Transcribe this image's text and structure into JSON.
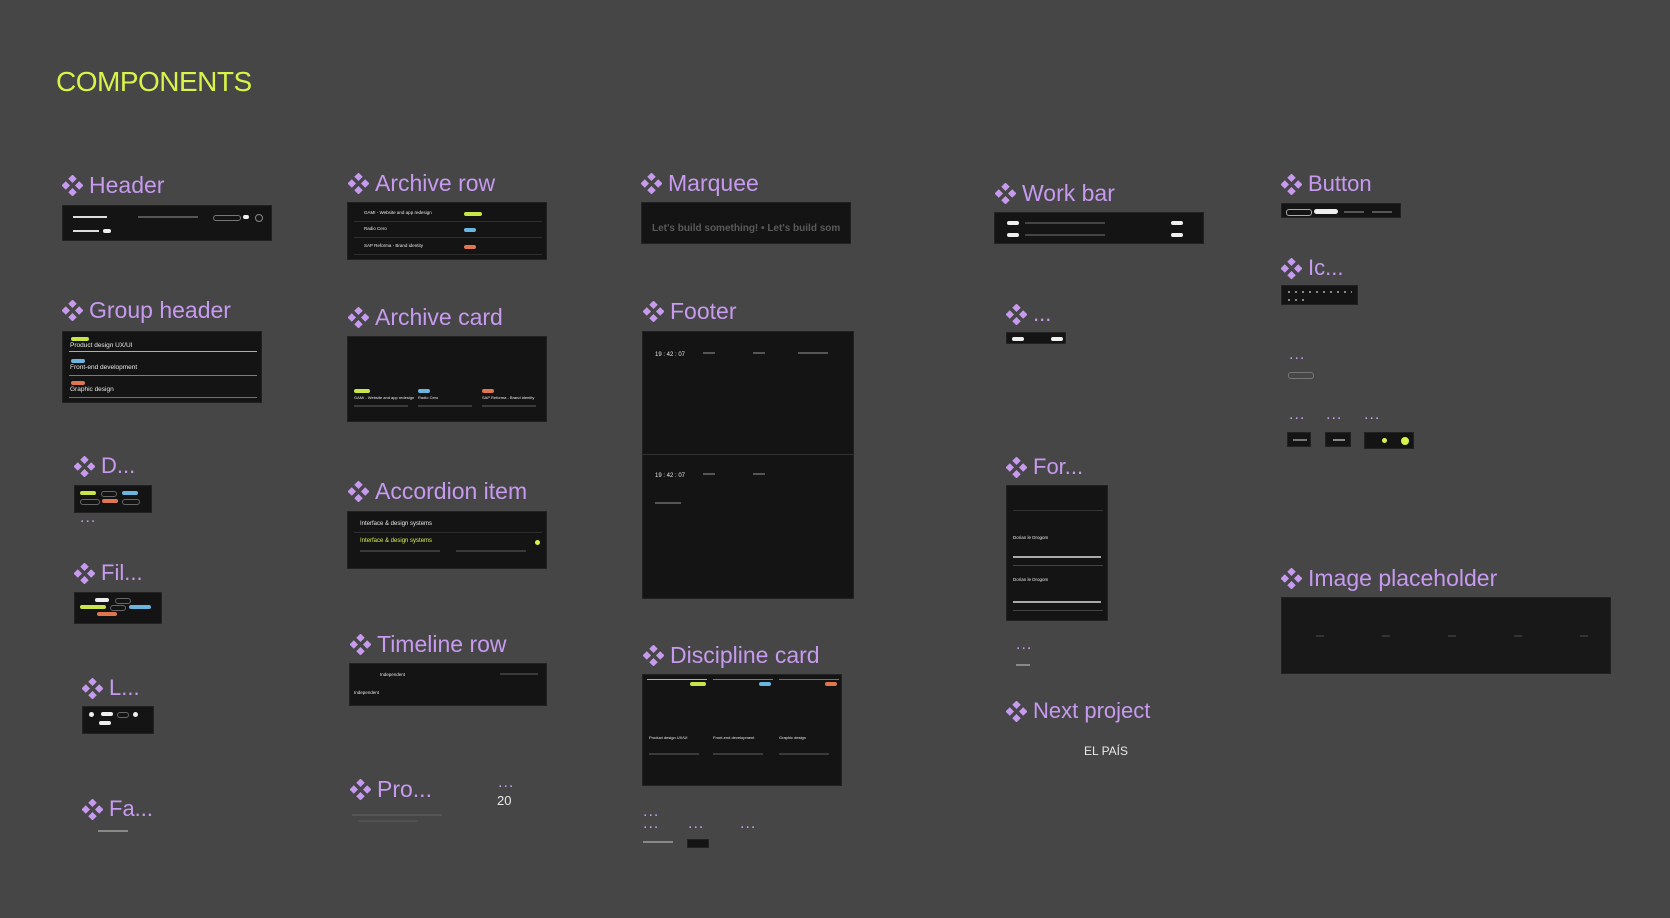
{
  "page": {
    "title": "COMPONENTS"
  },
  "colors": {
    "background": "#464646",
    "accent_title": "#d8f34a",
    "component_label": "#c79af0",
    "frame_bg": "#141414"
  },
  "icon": "component-diamond-icon",
  "components": {
    "header": "Header",
    "group_header": "Group header",
    "d": "D...",
    "fil": "Fil...",
    "l": "L...",
    "fa": "Fa...",
    "archive_row": "Archive row",
    "archive_card": "Archive card",
    "accordion_item": "Accordion item",
    "timeline_row": "Timeline row",
    "pro": "Pro...",
    "marquee": "Marquee",
    "footer": "Footer",
    "discipline_card": "Discipline card",
    "work_bar": "Work bar",
    "ellipsis": "...",
    "for": "For...",
    "next_project": "Next project",
    "button": "Button",
    "ic": "Ic...",
    "image_placeholder": "Image placeholder"
  },
  "ellipsis": "...",
  "misc": {
    "count": "20",
    "brand": "EL PAÍS"
  },
  "previews": {
    "group_header": [
      "Product design UX/UI",
      "Front-end development",
      "Graphic design"
    ],
    "archive_rows": [
      "GAMI - Website and app redesign",
      "Radio Cero",
      "SAP Reforma - Brand identity"
    ],
    "accordion": [
      "Interface & design systems",
      "Interface & design systems"
    ],
    "marquee": "Let's build something! • Let's build som",
    "timeline": [
      "Independent",
      "Independent"
    ],
    "footer_time": "19 : 42 : 07",
    "discipline": [
      "Product design UX/UI",
      "Front-end development",
      "Graphic design"
    ],
    "for_titles": [
      "Dorian le Drogom",
      "Dorian le Drogom"
    ]
  }
}
